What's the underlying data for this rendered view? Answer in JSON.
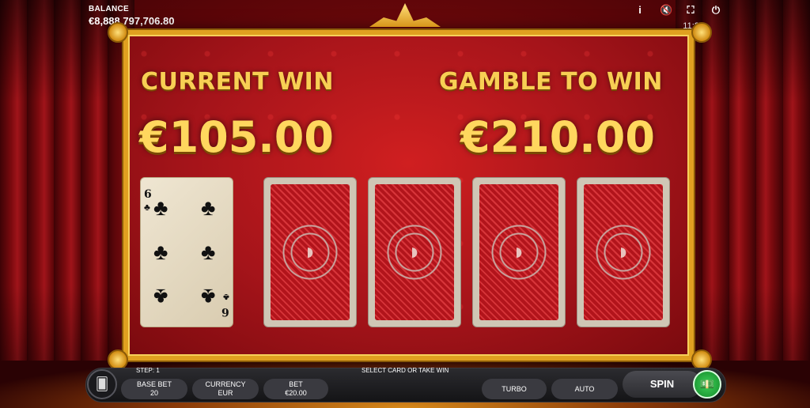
{
  "hud": {
    "balance_label": "BALANCE",
    "balance_value": "€8,888,797,706.80",
    "clock": "11:24",
    "icons": [
      "info-icon",
      "mute-icon",
      "fullscreen-icon",
      "power-icon"
    ],
    "info_glyph": "i",
    "mute_glyph": "🔇",
    "fullscreen_glyph": "⛶",
    "power_glyph": "⏻"
  },
  "gamble": {
    "current_label": "CURRENT WIN",
    "current_value": "€105.00",
    "gamble_label": "GAMBLE TO WIN",
    "gamble_value": "€210.00",
    "face_card": {
      "rank": "6",
      "suit": "♣"
    },
    "hidden_cards": 4
  },
  "controls": {
    "step": "STEP: 1",
    "message": "SELECT CARD OR TAKE WIN",
    "base_bet_label": "BASE BET",
    "base_bet_value": "20",
    "currency_label": "CURRENCY",
    "currency_value": "EUR",
    "bet_label": "BET",
    "bet_value": "€20.00",
    "turbo": "TURBO",
    "auto": "AUTO",
    "spin": "SPIN",
    "collect_glyph": "💵"
  },
  "colors": {
    "gold": "#f8cf54",
    "felt": "#c0181c",
    "green": "#2fb44a"
  }
}
